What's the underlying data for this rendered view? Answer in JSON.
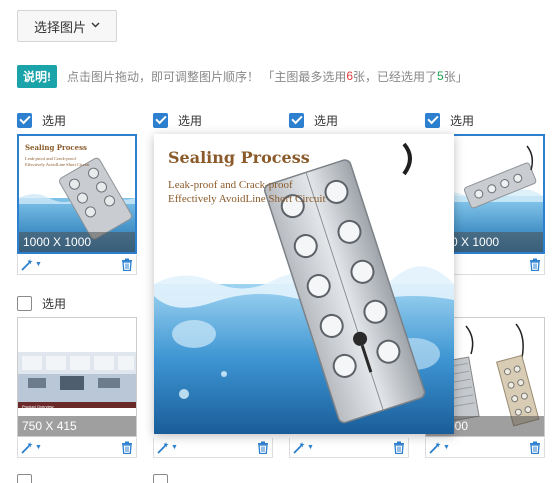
{
  "header": {
    "select_button_label": "选择图片",
    "notice_badge": "说明!",
    "notice_text_prefix": "点击图片拖动，即可调整图片顺序！ 「主图最多选用",
    "notice_max": "6",
    "notice_text_mid": "张，已经选用了",
    "notice_selected": "5",
    "notice_text_suffix": "张」"
  },
  "checkbox_label": "选用",
  "grid": {
    "row1": [
      {
        "checked": true,
        "size": "1000 X 1000"
      },
      {
        "checked": true,
        "size": ""
      },
      {
        "checked": true,
        "size": ""
      },
      {
        "checked": true,
        "size": "1000 X 1000"
      }
    ],
    "row2": [
      {
        "checked": false,
        "size": "750 X 415"
      },
      {
        "checked": false,
        "size": ""
      },
      {
        "checked": false,
        "size": ""
      },
      {
        "checked": false,
        "size": "X 1000"
      }
    ]
  },
  "thumb1": {
    "title": "Sealing Process",
    "sub": "Leak-proof and Crack-proof\nEffectively AvoidLine Short Circuit"
  },
  "thumb5_caption": "Product Overview",
  "preview": {
    "title": "Sealing Process",
    "subtitle": "Leak-proof and Crack-proof\nEffectively AvoidLine Short Circuit"
  },
  "icons": {
    "edit": "magic-wand-icon",
    "delete": "trash-icon",
    "dropdown": "chevron-down-icon"
  },
  "colors": {
    "accent": "#2d7fcf",
    "badge": "#1aa3a8",
    "max_num": "#e4393c",
    "selected_num": "#1aa34a",
    "title_brown": "#8a5a2a"
  }
}
